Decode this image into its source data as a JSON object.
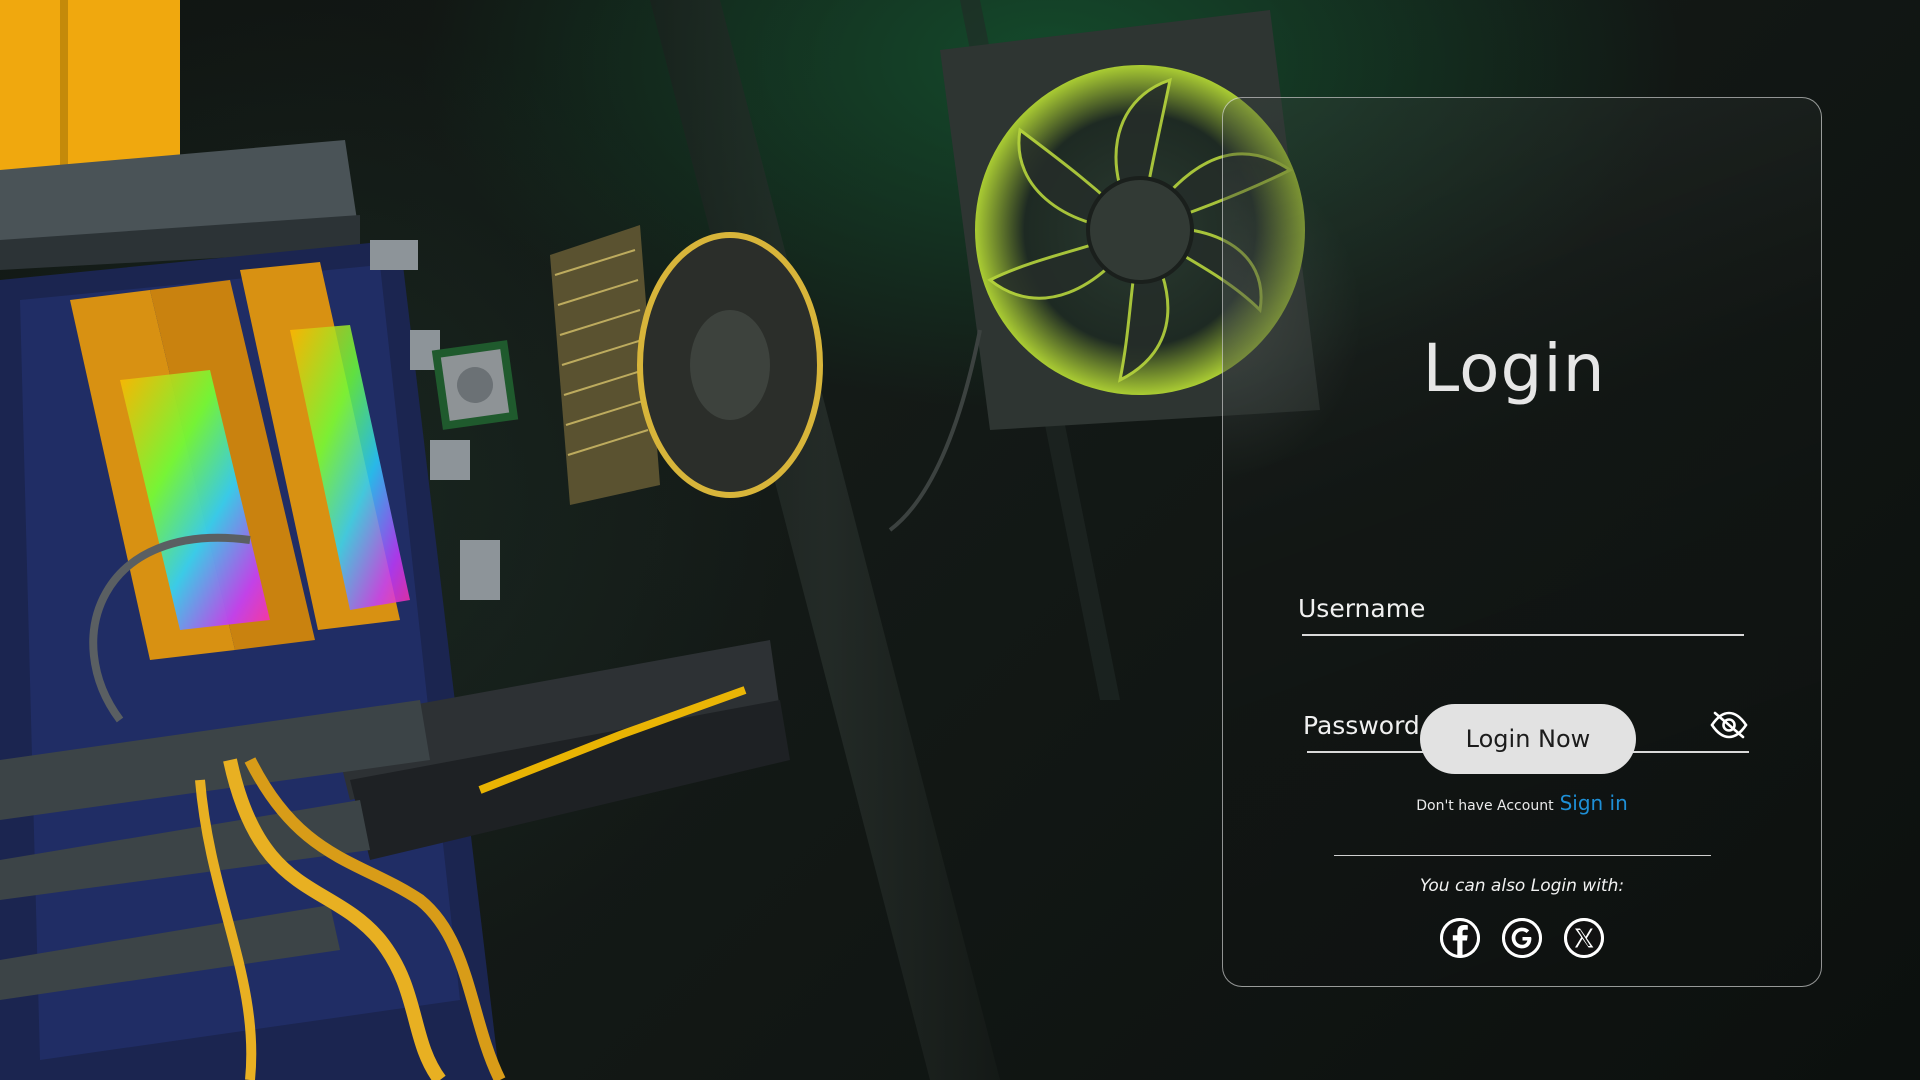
{
  "login": {
    "title": "Login",
    "username_placeholder": "Username",
    "password_placeholder": "Password",
    "button_label": "Login Now",
    "no_account_text": "Don't have Account",
    "signup_link": "Sign in",
    "alt_login_text": "You can also Login with:"
  },
  "social": [
    {
      "name": "facebook",
      "icon": "facebook-icon"
    },
    {
      "name": "google",
      "icon": "google-icon"
    },
    {
      "name": "x",
      "icon": "x-icon"
    }
  ],
  "colors": {
    "accent_link": "#1e8fd6",
    "button_bg": "#e2e2e2",
    "card_border": "#ffffff"
  }
}
